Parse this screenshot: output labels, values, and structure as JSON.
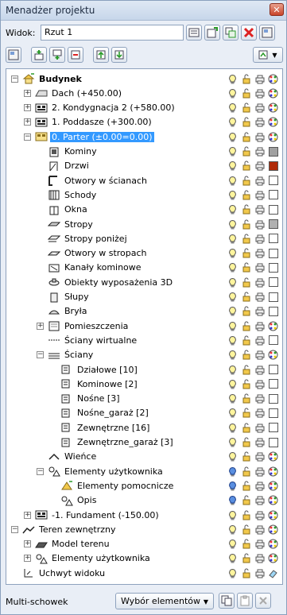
{
  "window": {
    "title": "Menadżer projektu"
  },
  "view": {
    "label": "Widok:",
    "value": "Rzut 1"
  },
  "tree": {
    "items": [
      {
        "label": "Budynek",
        "level": 0,
        "exp": "-",
        "icon": "building-icon",
        "bold": true
      },
      {
        "label": "Dach (+450.00)",
        "level": 1,
        "exp": "+",
        "icon": "roof-icon"
      },
      {
        "label": "2. Kondygnacja 2 (+580.00)",
        "level": 1,
        "exp": "+",
        "icon": "storey-icon"
      },
      {
        "label": "1. Poddasze (+300.00)",
        "level": 1,
        "exp": "+",
        "icon": "storey-icon"
      },
      {
        "label": "0. Parter (±0.00=0.00)",
        "level": 1,
        "exp": "-",
        "icon": "storey-active-icon",
        "selected": true
      },
      {
        "label": "Kominy",
        "level": 2,
        "icon": "chimney-icon"
      },
      {
        "label": "Drzwi",
        "level": 2,
        "icon": "door-icon"
      },
      {
        "label": "Otwory w ścianach",
        "level": 2,
        "icon": "wall-opening-icon"
      },
      {
        "label": "Schody",
        "level": 2,
        "icon": "stairs-icon"
      },
      {
        "label": "Okna",
        "level": 2,
        "icon": "window-icon"
      },
      {
        "label": "Stropy",
        "level": 2,
        "icon": "slab-icon"
      },
      {
        "label": "Stropy poniżej",
        "level": 2,
        "icon": "slab-below-icon"
      },
      {
        "label": "Otwory w stropach",
        "level": 2,
        "icon": "slab-opening-icon"
      },
      {
        "label": "Kanały kominowe",
        "level": 2,
        "icon": "flue-icon"
      },
      {
        "label": "Obiekty wyposażenia 3D",
        "level": 2,
        "icon": "furniture-icon"
      },
      {
        "label": "Słupy",
        "level": 2,
        "icon": "column-icon"
      },
      {
        "label": "Bryła",
        "level": 2,
        "icon": "solid-icon"
      },
      {
        "label": "Pomieszczenia",
        "level": 2,
        "exp": "+",
        "icon": "room-icon"
      },
      {
        "label": "Ściany wirtualne",
        "level": 2,
        "icon": "virtual-wall-icon"
      },
      {
        "label": "Ściany",
        "level": 2,
        "exp": "-",
        "icon": "walls-icon"
      },
      {
        "label": "Działowe [10]",
        "level": 3,
        "icon": "wall-group-icon"
      },
      {
        "label": "Kominowe [2]",
        "level": 3,
        "icon": "wall-group-icon"
      },
      {
        "label": "Nośne [3]",
        "level": 3,
        "icon": "wall-group-icon"
      },
      {
        "label": "Nośne_garaż [2]",
        "level": 3,
        "icon": "wall-group-icon"
      },
      {
        "label": "Zewnętrzne [16]",
        "level": 3,
        "icon": "wall-group-icon"
      },
      {
        "label": "Zewnętrzne_garaż [3]",
        "level": 3,
        "icon": "wall-group-icon"
      },
      {
        "label": "Wieńce",
        "level": 2,
        "icon": "ring-beam-icon"
      },
      {
        "label": "Elementy użytkownika",
        "level": 2,
        "exp": "-",
        "icon": "user-elements-icon"
      },
      {
        "label": "Elementy pomocnicze",
        "level": 3,
        "icon": "helper-elements-icon"
      },
      {
        "label": "Opis",
        "level": 3,
        "icon": "description-icon"
      },
      {
        "label": "-1. Fundament (-150.00)",
        "level": 1,
        "exp": "+",
        "icon": "storey-icon"
      },
      {
        "label": "Teren zewnętrzny",
        "level": 0,
        "exp": "-",
        "icon": "terrain-icon"
      },
      {
        "label": "Model terenu",
        "level": 1,
        "exp": "+",
        "icon": "terrain-model-icon"
      },
      {
        "label": "Elementy użytkownika",
        "level": 1,
        "exp": "+",
        "icon": "user-elements-icon"
      },
      {
        "label": "Uchwyt widoku",
        "level": 0,
        "icon": "view-handle-icon"
      }
    ],
    "colors": {
      "Kominy": "#a0a0a0",
      "Drzwi": "#b02a08",
      "Stropy": "#b0b0b0",
      "Stropy poniżej": "#ffffff",
      "Otwory w stropach": "#ffffff",
      "Kanały kominowe": "#ffffff",
      "Obiekty wyposażenia 3D": "#ffffff",
      "Słupy": "#ffffff",
      "Bryła": "#ffffff",
      "Pomieszczenia": "#ffffff",
      "Ściany wirtualne": "#ffffff"
    }
  },
  "bottom": {
    "label": "Multi-schowek",
    "dropdown": "Wybór elementów"
  }
}
